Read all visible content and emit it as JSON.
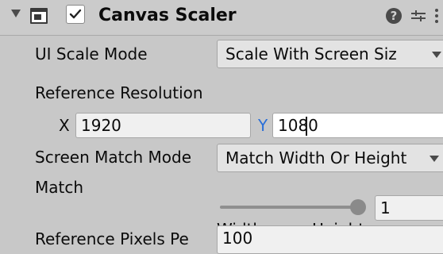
{
  "header": {
    "title": "Canvas Scaler",
    "enabled": true,
    "icons": [
      "foldout-arrow-icon",
      "component-icon",
      "checkbox-check-icon",
      "help-icon",
      "presets-icon",
      "more-menu-icon"
    ]
  },
  "fields": {
    "ui_scale_mode": {
      "label": "UI Scale Mode",
      "value": "Scale With Screen Siz"
    },
    "reference_resolution": {
      "label": "Reference Resolution",
      "x_label": "X",
      "x_value": "1920",
      "y_label": "Y",
      "y_value": "1080"
    },
    "screen_match_mode": {
      "label": "Screen Match Mode",
      "value": "Match Width Or Height"
    },
    "match": {
      "label": "Match",
      "value": "1",
      "slider_fraction": 1.0,
      "min_label": "Width",
      "max_label": "Height"
    },
    "reference_pixels": {
      "label": "Reference Pixels Pe",
      "value": "100"
    }
  },
  "colors": {
    "background": "#c8c8c8",
    "field": "#f0f0f0",
    "dropdown": "#e3e3e3",
    "y_axis_label": "#2a6fd8"
  }
}
